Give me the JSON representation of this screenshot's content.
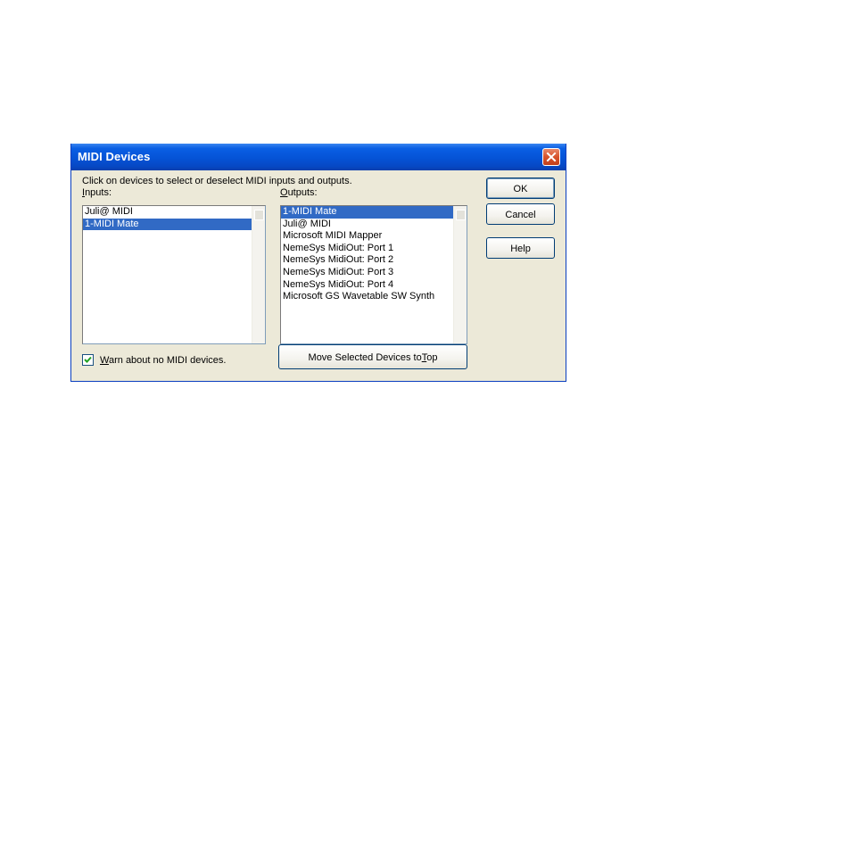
{
  "window": {
    "title": "MIDI Devices",
    "close_icon": "close-icon",
    "title_color": "#0553d6",
    "close_color": "#d7532b"
  },
  "instruction": "Click on devices to select or deselect MIDI inputs and outputs.",
  "inputs": {
    "label_accel": "I",
    "label_rest": "nputs:",
    "items": [
      {
        "label": "Juli@ MIDI",
        "selected": false
      },
      {
        "label": "1-MIDI Mate",
        "selected": true
      }
    ]
  },
  "outputs": {
    "label_accel": "O",
    "label_rest": "utputs:",
    "items": [
      {
        "label": "1-MIDI Mate",
        "selected": true
      },
      {
        "label": "Juli@ MIDI",
        "selected": false
      },
      {
        "label": "Microsoft MIDI Mapper",
        "selected": false
      },
      {
        "label": "NemeSys MidiOut: Port 1",
        "selected": false
      },
      {
        "label": "NemeSys MidiOut: Port 2",
        "selected": false
      },
      {
        "label": "NemeSys MidiOut: Port 3",
        "selected": false
      },
      {
        "label": "NemeSys MidiOut: Port 4",
        "selected": false
      },
      {
        "label": "Microsoft GS Wavetable SW Synth",
        "selected": false
      }
    ]
  },
  "buttons": {
    "ok": "OK",
    "cancel": "Cancel",
    "help": "Help",
    "move_prefix": "Move Selected Devices to ",
    "move_accel": "T",
    "move_suffix": "op"
  },
  "warn": {
    "checked": true,
    "accel": "W",
    "rest": "arn about no MIDI devices."
  },
  "colors": {
    "selection": "#316ac5",
    "dialog_bg": "#ece9d8"
  }
}
